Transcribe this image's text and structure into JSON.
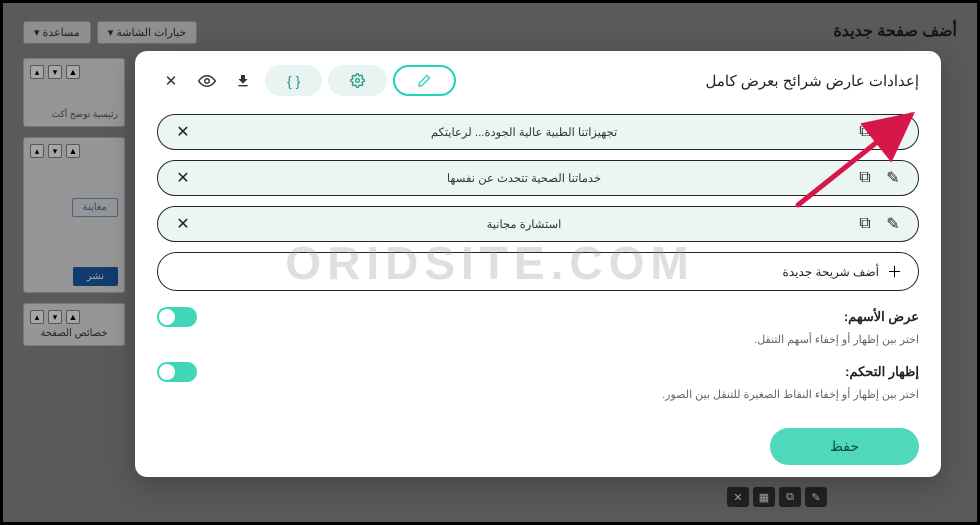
{
  "bg": {
    "page_title": "أضف صفحة جديدة",
    "dd_screen": "خيارات الشاشة ▾",
    "dd_help": "مساعدة ▾",
    "sidebar_text": "رئيسية توضح أكث",
    "preview": "معاينة",
    "publish": "نشر",
    "props_title": "خصائص الصفحة"
  },
  "modal": {
    "title": "إعدادات عارض شرائح بعرض كامل",
    "slides": [
      {
        "text": "تجهيزاتنا الطبية عالية الجودة... لرعايتكم"
      },
      {
        "text": "خدماتنا الصحية تتحدث عن نفسها"
      },
      {
        "text": "استشارة مجانية"
      }
    ],
    "add_slide": "أضف شريحة جديدة",
    "settings": {
      "arrows_label": "عرض الأسهم:",
      "arrows_desc": "اختر بين إظهار أو إخفاء أسهم التنقل.",
      "controls_label": "إظهار التحكم:",
      "controls_desc": "اختر بين إظهار أو إخفاء النقاط الصغيرة للتنقل بين الصور."
    },
    "save": "حفظ"
  },
  "watermark": "ORIDSITE.COM"
}
